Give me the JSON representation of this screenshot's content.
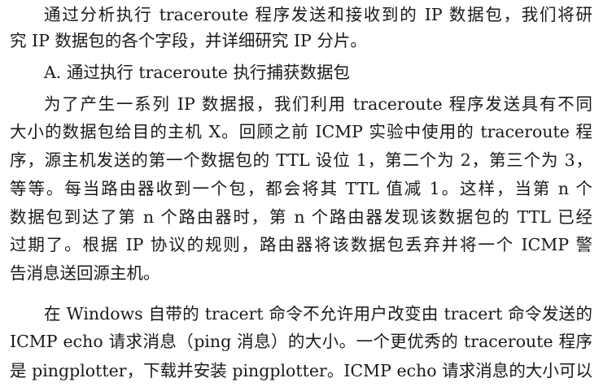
{
  "document": {
    "intro": {
      "lines": [
        "通过分析执行 traceroute 程序发送和接收到的 IP 数据包，我们将研",
        "究 IP 数据包的各个字段，并详细研究 IP 分片。"
      ]
    },
    "section_heading": "A. 通过执行 traceroute 执行捕获数据包",
    "paragraph1": {
      "lines": [
        "为了产生一系列 IP 数据报，我们利用 traceroute 程序发送具有不同",
        "大小的数据包给目的主机 X。回顾之前 ICMP 实验中使用的 traceroute 程",
        "序，源主机发送的第一个数据包的 TTL 设位 1，第二个为 2，第三个为 3，",
        "等等。每当路由器收到一个包，都会将其 TTL 值减 1。这样，当第 n 个",
        "数据包到达了第 n 个路由器时，第 n 个路由器发现该数据包的 TTL 已经",
        "过期了。根据 IP 协议的规则，路由器将该数据包丢弃并将一个 ICMP 警",
        "告消息送回源主机。"
      ]
    },
    "paragraph2": {
      "lines": [
        "在 Windows 自带的 tracert 命令不允许用户改变由 tracert 命令发送的",
        "ICMP echo 请求消息（ping 消息）的大小。一个更优秀的 traceroute 程序",
        "是 pingplotter，下载并安装 pingplotter。ICMP echo 请求消息的大小可以"
      ]
    }
  }
}
